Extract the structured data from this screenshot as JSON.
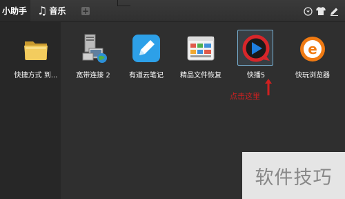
{
  "tabs": {
    "helper_label": "小助手",
    "music_label": "音乐",
    "add_symbol": "+"
  },
  "top_icons": [
    "chevron-down-icon",
    "tshirt-icon",
    "pencil-icon"
  ],
  "icons": [
    {
      "label": "快捷方式 到...",
      "icon": "folder-icon"
    },
    {
      "label": "宽带连接 2",
      "icon": "network-connection-icon"
    },
    {
      "label": "有道云笔记",
      "icon": "youdao-note-icon"
    },
    {
      "label": "精品文件恢复",
      "icon": "file-recovery-icon"
    },
    {
      "label": "快播5",
      "icon": "qvod-player-icon",
      "selected": true
    },
    {
      "label": "快玩浏览器",
      "icon": "kuaiwan-browser-icon"
    }
  ],
  "annotation": {
    "text": "点击这里",
    "color": "#d02020"
  },
  "watermark": {
    "text": "软件技巧"
  },
  "colors": {
    "background": "#2b2b2b",
    "selection_border": "#7ab3d6",
    "annotation": "#d02020"
  }
}
